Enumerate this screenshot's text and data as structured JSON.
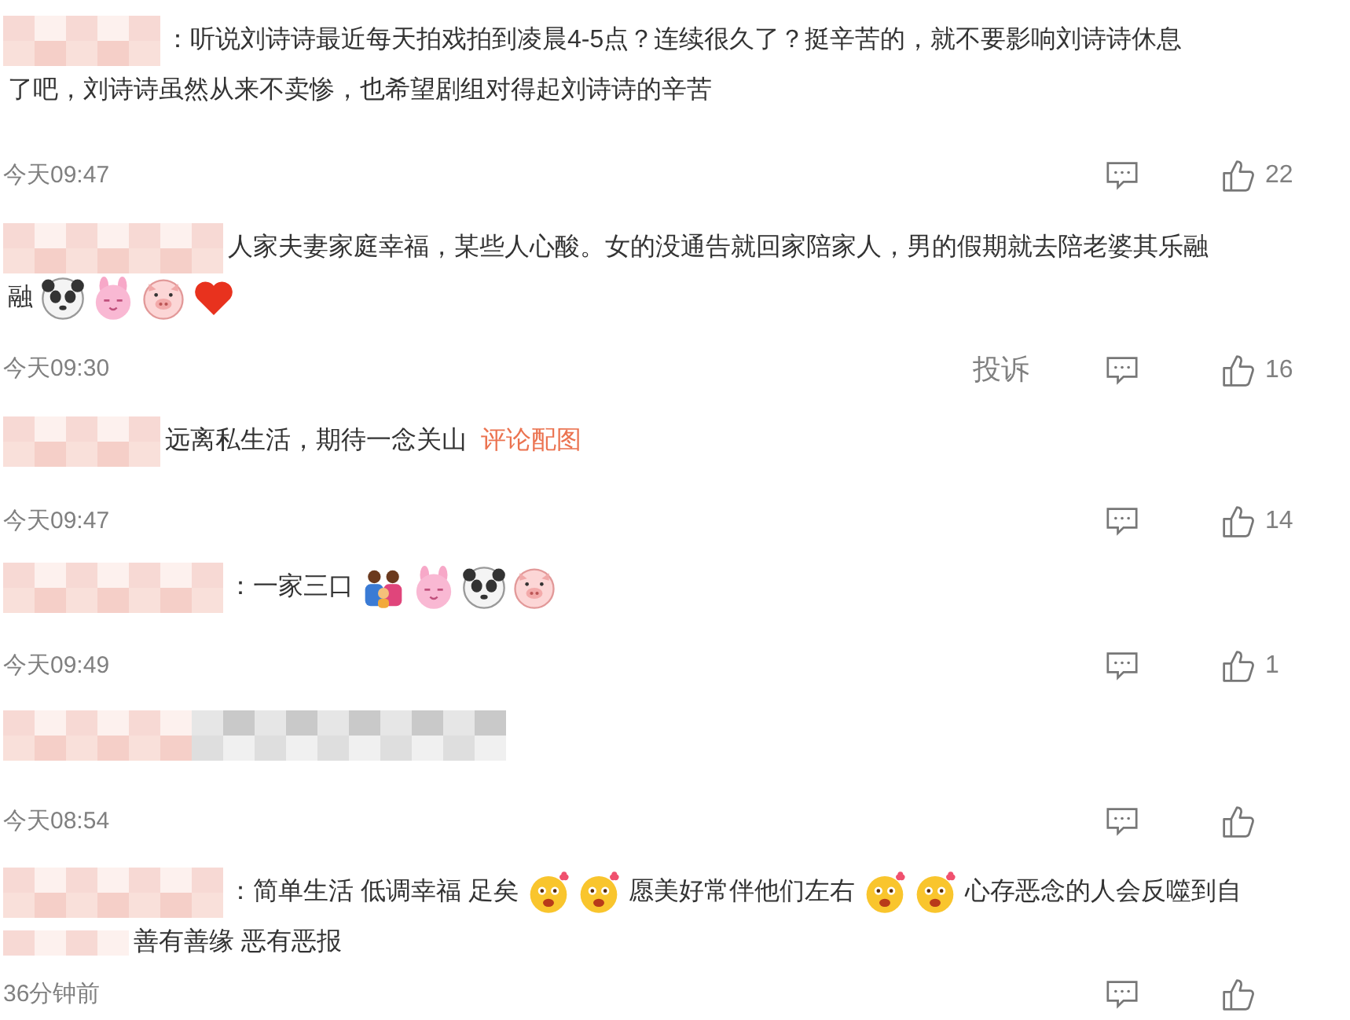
{
  "comments": [
    {
      "content": [
        {
          "kind": "text",
          "text": "：听说刘诗诗最近每天拍戏拍到凌晨4-5点？连续很久了？挺辛苦的，就不要影响刘诗诗休息"
        },
        {
          "kind": "break"
        },
        {
          "kind": "text",
          "text": "了吧，刘诗诗虽然从来不卖惨，也希望剧组对得起刘诗诗的辛苦"
        }
      ],
      "time": "今天09:47",
      "likes": "22"
    },
    {
      "content": [
        {
          "kind": "text",
          "text": "人家夫妻家庭幸福，某些人心酸。女的没通告就回家陪家人，男的假期就去陪老婆其乐融"
        },
        {
          "kind": "break"
        },
        {
          "kind": "text",
          "text": "融"
        },
        {
          "kind": "panda"
        },
        {
          "kind": "rabbit"
        },
        {
          "kind": "pig"
        },
        {
          "kind": "heart"
        }
      ],
      "time": "今天09:30",
      "report": "投诉",
      "likes": "16"
    },
    {
      "content": [
        {
          "kind": "text",
          "text": "远离私生活，期待一念关山"
        },
        {
          "kind": "link",
          "text": "评论配图"
        }
      ],
      "time": "今天09:47",
      "likes": "14"
    },
    {
      "content": [
        {
          "kind": "text",
          "text": "：一家三口"
        },
        {
          "kind": "family"
        },
        {
          "kind": "rabbit"
        },
        {
          "kind": "panda"
        },
        {
          "kind": "pig"
        }
      ],
      "time": "今天09:49",
      "likes": "1"
    },
    {
      "time": "今天08:54"
    },
    {
      "content": [
        {
          "kind": "text",
          "text": "：简单生活 低调幸福 足矣"
        },
        {
          "kind": "blush"
        },
        {
          "kind": "blush"
        },
        {
          "kind": "text",
          "text": "愿美好常伴他们左右"
        },
        {
          "kind": "blush"
        },
        {
          "kind": "blush"
        },
        {
          "kind": "text",
          "text": "心存恶念的人会反噬到自"
        },
        {
          "kind": "break"
        },
        {
          "kind": "mosaic"
        },
        {
          "kind": "text",
          "text": "善有善缘 恶有恶报"
        }
      ],
      "time": "36分钟前"
    }
  ]
}
